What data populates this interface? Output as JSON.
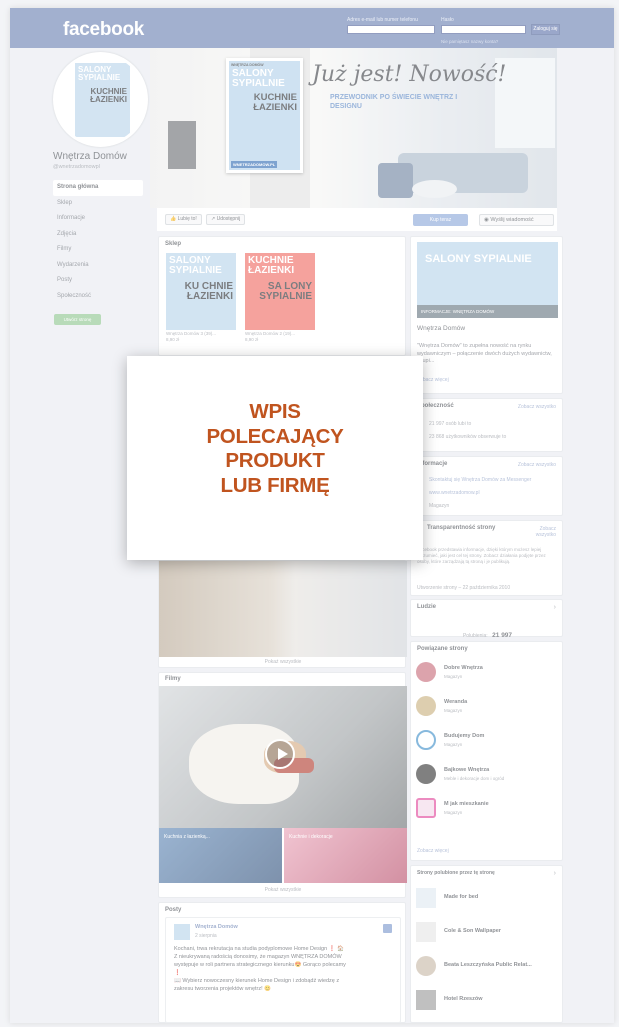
{
  "topbar": {
    "logo": "facebook",
    "email_label": "Adres e-mail lub numer telefonu",
    "password_label": "Hasło",
    "login_button": "Zaloguj się",
    "forgot_link": "Nie pamiętasz nazwy konta?"
  },
  "profile": {
    "name": "Wnętrza Domów",
    "handle": "@wnetrzadomowpl",
    "avatar_title_top": "SALONY SYPIALNIE",
    "avatar_title_bottom": "KUCHNIE ŁAZIENKI",
    "create_page": "Utwórz stronę"
  },
  "leftnav": [
    "Strona główna",
    "Sklep",
    "Informacje",
    "Zdjęcia",
    "Filmy",
    "Wydarzenia",
    "Posty",
    "Społeczność"
  ],
  "cover": {
    "script_text": "Już jest! Nowość!",
    "subtitle": "PRZEWODNIK PO ŚWIECIE WNĘTRZ I DESIGNU",
    "mag_brand": "WNĘTRZA DOMÓW",
    "mag_title_top": "SALONY SYPIALNIE",
    "mag_title_bottom": "KUCHNIE ŁAZIENKI",
    "mag_url": "WNETRZADOMOW.PL"
  },
  "actions": {
    "like": "Lubię to!",
    "share": "Udostępnij",
    "shop": "Kup teraz",
    "message": "Wyślij wiadomość"
  },
  "shop": {
    "title": "Sklep",
    "items": [
      {
        "caption": "Wnętrza Domów 3 (39)...",
        "price": "8,90 zł",
        "t1": "SALONY SYPIALNIE",
        "t2": "KU CHNIE ŁAZIENKI"
      },
      {
        "caption": "Wnętrza Domów 2 (19)...",
        "price": "8,90 zł",
        "t1": "KUCHNIE ŁAZIENKI",
        "t2": "SA LONY SYPIALNIE"
      }
    ]
  },
  "photos": {
    "see_all": "Pokaż wszystkie"
  },
  "videos": {
    "title": "Filmy",
    "thumb1": "Kuchnia z łazienką...",
    "thumb2": "Kuchnie i dekoracje",
    "see_all": "Pokaż wszystkie"
  },
  "posts": {
    "title": "Posty",
    "author": "Wnętrza Domów",
    "date": "2 sierpnia",
    "text1": "Kochani, trwa rekrutacja na studia podyplomowe Home Design ❗ 🏠",
    "text2": "Z nieukrywaną radością donosimy, że magazyn WNĘTRZA DOMÓW",
    "text3": "występuje w roli partnera strategicznego kierunku😍 Gorąco polecamy",
    "text4": "❗",
    "text5": "📖 Wybierz nowoczesny kierunek Home Design i zdobądź wiedzę z",
    "text6": "zakresu tworzenia projektów wnętrz! 😊"
  },
  "about": {
    "banner": "INFORMACJE: WNĘTRZA DOMÓW",
    "name": "Wnętrza Domów",
    "desc": "\"Wnętrza Domów\" to zupełna nowość na rynku wydawniczym – połączenie dwóch dużych wydawnictw, skupi...",
    "more": "Zobacz więcej"
  },
  "community": {
    "title": "Społeczność",
    "link": "Zobacz wszystko",
    "likes": "21 997 osób lubi to",
    "follows": "23 868 użytkowników obserwuje to"
  },
  "info": {
    "title": "Informacje",
    "link": "Zobacz wszystko",
    "contact": "Skontaktuj się Wnętrza Domów za Messenger",
    "site": "www.wnetrzadomow.pl",
    "cat": "Magazyn"
  },
  "transparency": {
    "title": "Transparentność strony",
    "link": "Zobacz wszystko",
    "desc": "Facebook przedstawia informacje, dzięki którym możesz lepiej zrozumieć, jaki jest cel tej strony. Zobacz działania podjęte przez osoby, które zarządzają tą stroną i je publikują.",
    "created": "Utworzenie strony – 22 października 2010"
  },
  "people": {
    "title": "Ludzie",
    "likes_label": "Polubienia:",
    "likes_value": "21 997"
  },
  "related": {
    "title": "Powiązane strony",
    "items": [
      {
        "name": "Dobre Wnętrza",
        "sub": "Magazyn",
        "color": "#c76b7a"
      },
      {
        "name": "Weranda",
        "sub": "Magazyn",
        "color": "#c9b07e"
      },
      {
        "name": "Budujemy Dom",
        "sub": "Magazyn",
        "color": "#3e8ec8"
      },
      {
        "name": "Bajkowe Wnętrza",
        "sub": "Meble i dekoracje dom i ogród",
        "color": "#333333"
      },
      {
        "name": "M jak mieszkanie",
        "sub": "Magazyn",
        "color": "#e0459a"
      }
    ],
    "more": "Zobacz więcej"
  },
  "liked_pages": {
    "title": "Strony polubione przez tę stronę",
    "items": [
      "Made for bed",
      "Cole & Son Wallpaper",
      "Beata Leszczyńska Public Relat...",
      "Hotel Rzeszów"
    ]
  },
  "promo": {
    "line1": "WPIS",
    "line2": "POLECAJĄCY",
    "line3": "PRODUKT",
    "line4": "LUB FIRMĘ"
  }
}
